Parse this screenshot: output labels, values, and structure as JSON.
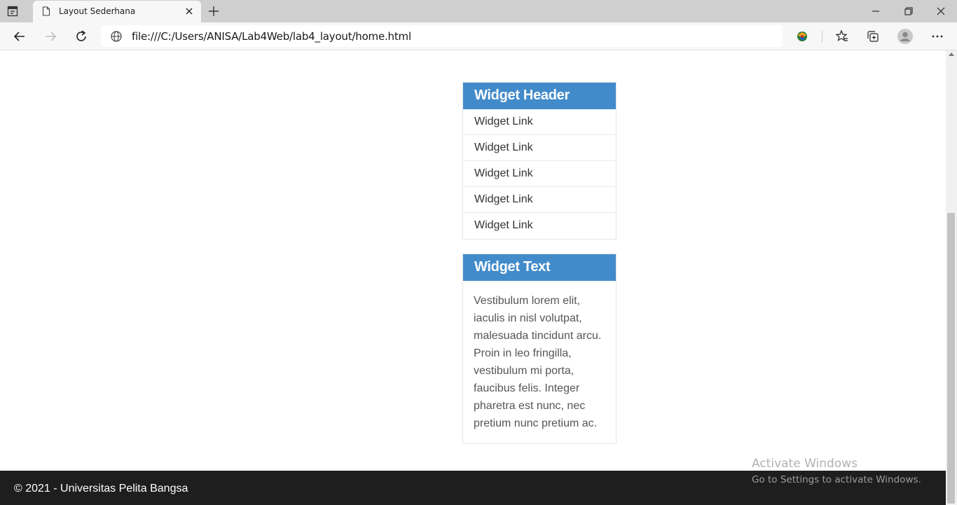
{
  "browser": {
    "tab_title": "Layout Sederhana",
    "url": "file:///C:/Users/ANISA/Lab4Web/lab4_layout/home.html"
  },
  "widgets": {
    "header": {
      "title": "Widget Header",
      "links": [
        "Widget Link",
        "Widget Link",
        "Widget Link",
        "Widget Link",
        "Widget Link"
      ]
    },
    "text": {
      "title": "Widget Text",
      "body_lines": [
        "Vestibulum lorem elit,",
        "iaculis in nisl volutpat,",
        "malesuada tincidunt arcu.",
        "Proin in leo fringilla,",
        "vestibulum mi porta,",
        "faucibus felis. Integer",
        "pharetra est nunc, nec",
        "pretium nunc pretium ac."
      ]
    }
  },
  "footer": {
    "copyright": "© 2021 - Universitas Pelita Bangsa"
  },
  "watermark": {
    "line1": "Activate Windows",
    "line2": "Go to Settings to activate Windows."
  },
  "colors": {
    "widget_header_bg": "#428bca",
    "footer_bg": "#1e1e1e"
  }
}
